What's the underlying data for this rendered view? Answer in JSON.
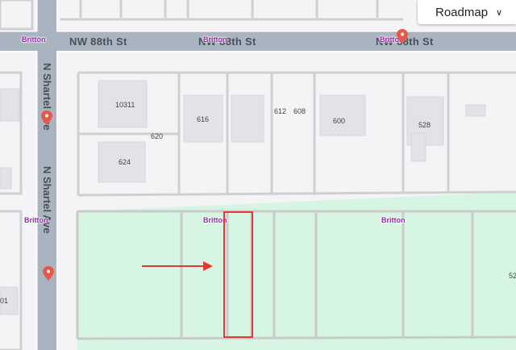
{
  "map_type": {
    "label": "Roadmap",
    "caret": "∨"
  },
  "streets": {
    "nw88_a": "NW 88th St",
    "nw88_b": "NW 88th St",
    "nw88_c": "NW 88th St",
    "shartel_a": "N Shartel Ave",
    "shartel_b": "N Shartel Ave"
  },
  "district_labels": [
    "Britton",
    "Britton",
    "Britton",
    "Britton",
    "Britton",
    "Britton"
  ],
  "house_numbers": [
    "10311",
    "620",
    "616",
    "612",
    "608",
    "600",
    "528",
    "624",
    "52",
    "01"
  ],
  "colors": {
    "road": "#aab4c1",
    "lot_line": "#cfd0d2",
    "building": "#e2e3e6",
    "park": "#d6f5e3",
    "highlight": "#e53935",
    "pin": "#e8574a",
    "district": "#9c27b0"
  },
  "icons": {
    "pin": "map-pin-icon",
    "arrow": "annotation-arrow-icon",
    "highlight": "highlight-box"
  }
}
